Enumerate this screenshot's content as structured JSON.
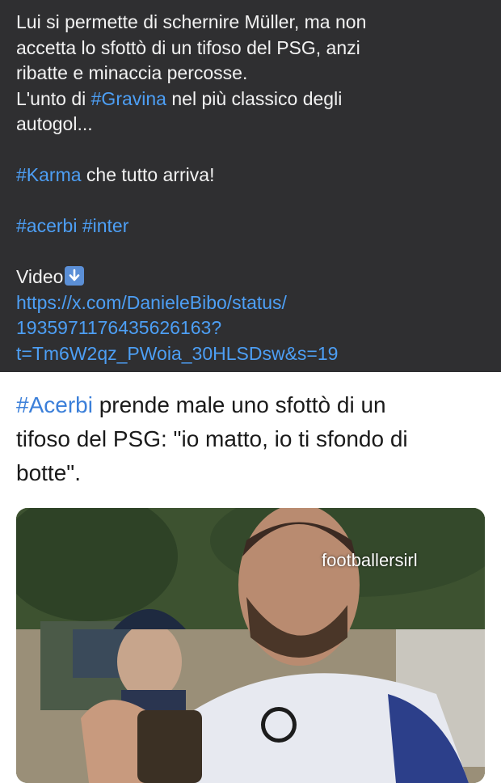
{
  "top_post": {
    "line1": "Lui si permette di schernire Müller, ma non",
    "line2": "accetta lo sfottò di un tifoso del PSG, anzi",
    "line3": "ribatte e minaccia percosse.",
    "line4_prefix": "L'unto di ",
    "line4_tag": "#Gravina",
    "line4_suffix": " nel più classico degli",
    "line5": "autogol...",
    "karma_tag": "#Karma",
    "karma_suffix": " che tutto arriva!",
    "tag_acerbi": "#acerbi",
    "tag_inter": "#inter",
    "video_label": "Video",
    "video_icon": "down-arrow-icon",
    "link_line1": "https://x.com/DanieleBibo/status/",
    "link_line2": "1935971176435626163?",
    "link_line3": "t=Tm6W2qz_PWoia_30HLSDsw&s=19"
  },
  "quoted_post": {
    "tag": "#Acerbi",
    "text_line1_suffix": " prende male uno sfottò di un",
    "text_line2": "tifoso del PSG: \"io matto, io ti sfondo di",
    "text_line3": "botte\".",
    "media_watermark": "footballersirl"
  },
  "colors": {
    "dark_bg": "#2f2f31",
    "link_blue": "#4d9ff5",
    "light_link_blue": "#3b7fd9"
  }
}
